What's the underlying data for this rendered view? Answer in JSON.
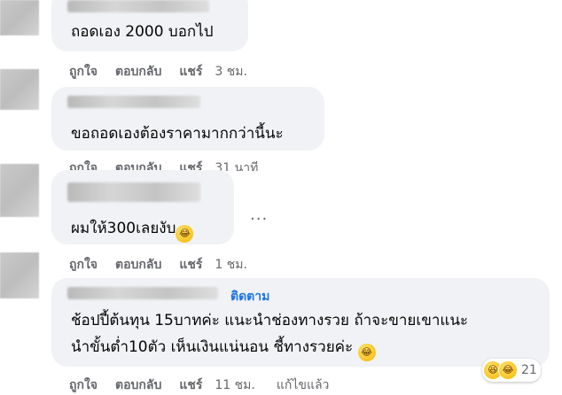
{
  "comments": [
    {
      "text": "ถอดเอง 2000 บอกไป",
      "actions": {
        "like": "ถูกใจ",
        "reply": "ตอบกลับ",
        "share": "แชร์",
        "time": "3 ชม."
      }
    },
    {
      "text": "ขอถอดเองต้องราคามากกว่านี้นะ",
      "actions": {
        "like": "ถูกใจ",
        "reply": "ตอบกลับ",
        "share": "แชร์",
        "time": "31 นาที"
      }
    },
    {
      "text": "ผมให้300เลยงับ",
      "emoji": "🤣",
      "more": "...",
      "actions": {
        "like": "ถูกใจ",
        "reply": "ตอบกลับ",
        "share": "แชร์",
        "time": "1 ชม."
      }
    },
    {
      "follow": "ติดตาม",
      "line1": "ช้อปปี้ต้นทุน 15บาทค่ะ แนะนำช่องทางรวย ถ้าจะขายเขาแนะ",
      "line2": "นำขั้นต่ำ10ตัว เห็นเงินแน่นอน ชี้ทางรวยค่ะ",
      "emoji": "🤣",
      "reactions": {
        "count": "21",
        "icons": [
          "haha",
          "laugh"
        ]
      },
      "actions": {
        "like": "ถูกใจ",
        "reply": "ตอบกลับ",
        "share": "แชร์",
        "time": "11 ชม.",
        "edited": "แก้ไขแล้ว"
      }
    }
  ],
  "colors": {
    "bubble": "#f0f2f5",
    "meta": "#65676b",
    "link": "#1b74e4",
    "text": "#050505"
  }
}
